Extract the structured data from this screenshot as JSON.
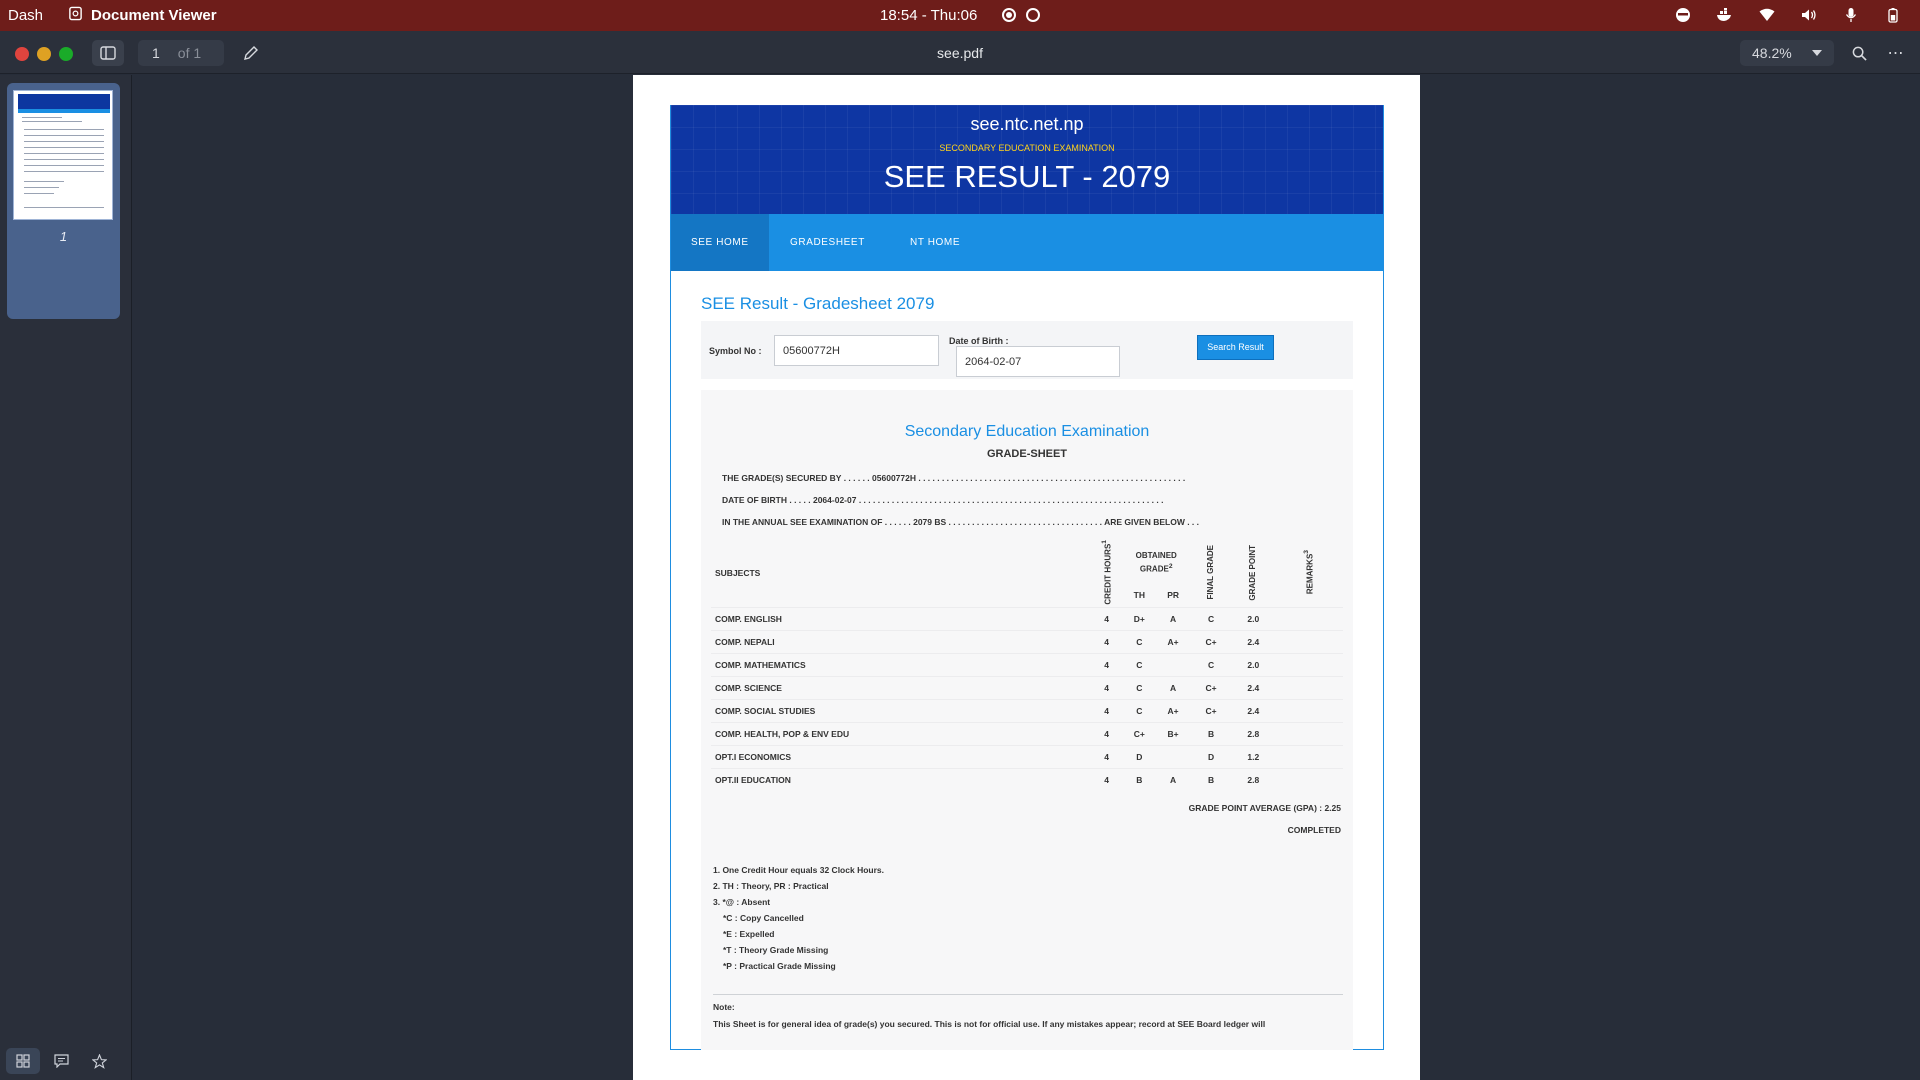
{
  "system_bar": {
    "dash_label": "Dash",
    "app_name": "Document Viewer",
    "clock": "18:54 - Thu:06"
  },
  "toolbar": {
    "page_number": "1",
    "page_of": "of 1",
    "file_name": "see.pdf",
    "zoom": "48.2%"
  },
  "sidebar": {
    "thumbnail_label": "1"
  },
  "document": {
    "site_domain": "see.ntc.net.np",
    "site_subtitle": "SECONDARY EDUCATION EXAMINATION",
    "site_title": "SEE RESULT - 2079",
    "nav": [
      "SEE HOME",
      "GRADESHEET",
      "NT HOME"
    ],
    "gradesheet_title": "SEE Result - Gradesheet 2079",
    "form": {
      "symbol_label": "Symbol No :",
      "symbol_value": "05600772H",
      "dob_label": "Date of Birth :",
      "dob_value": "2064-02-07",
      "search_button": "Search Result"
    },
    "sheet": {
      "title": "Secondary Education Examination",
      "subtitle": "GRADE-SHEET",
      "line1": "THE GRADE(S) SECURED BY . . . . . . 05600772H . . . . . . . . . . . . . . . . . . . . . . . . . . . . . . . . . . . . . . . . . . . . . . . . . . . . . . . . .",
      "line2": "DATE OF BIRTH . . . . . 2064-02-07 . . . . . . . . . . . . . . . . . . . . . . . . . . . . . . . . . . . . . . . . . . . . . . . . . . . . . . . . . . . . . . . . .",
      "line3": "IN THE ANNUAL SEE EXAMINATION OF . . . . . . 2079 BS . . . . . . . . . . . . . . . . . . . . . . . . . . . . . . . . . ARE GIVEN BELOW . . .",
      "headers": {
        "subjects": "SUBJECTS",
        "credit_hours": "CREDIT HOURS",
        "credit_sup": "1",
        "obtained_grade": "OBTAINED GRADE",
        "obtained_sup": "2",
        "th": "TH",
        "pr": "PR",
        "final_grade": "FINAL GRADE",
        "grade_point": "GRADE POINT",
        "remarks": "REMARKS",
        "remarks_sup": "3"
      },
      "rows": [
        {
          "subject": "COMP. ENGLISH",
          "credit": "4",
          "th": "D+",
          "pr": "A",
          "final": "C",
          "gp": "2.0"
        },
        {
          "subject": "COMP. NEPALI",
          "credit": "4",
          "th": "C",
          "pr": "A+",
          "final": "C+",
          "gp": "2.4"
        },
        {
          "subject": "COMP. MATHEMATICS",
          "credit": "4",
          "th": "C",
          "pr": "",
          "final": "C",
          "gp": "2.0"
        },
        {
          "subject": "COMP. SCIENCE",
          "credit": "4",
          "th": "C",
          "pr": "A",
          "final": "C+",
          "gp": "2.4"
        },
        {
          "subject": "COMP. SOCIAL STUDIES",
          "credit": "4",
          "th": "C",
          "pr": "A+",
          "final": "C+",
          "gp": "2.4"
        },
        {
          "subject": "COMP. HEALTH, POP & ENV EDU",
          "credit": "4",
          "th": "C+",
          "pr": "B+",
          "final": "B",
          "gp": "2.8"
        },
        {
          "subject": "OPT.I ECONOMICS",
          "credit": "4",
          "th": "D",
          "pr": "",
          "final": "D",
          "gp": "1.2"
        },
        {
          "subject": "OPT.II EDUCATION",
          "credit": "4",
          "th": "B",
          "pr": "A",
          "final": "B",
          "gp": "2.8"
        }
      ],
      "gpa": "GRADE POINT AVERAGE (GPA) : 2.25",
      "status": "COMPLETED",
      "footnotes": [
        "1. One Credit Hour equals 32 Clock Hours.",
        "2. TH : Theory, PR : Practical",
        "3. *@ : Absent",
        "*C : Copy Cancelled",
        "*E : Expelled",
        "*T : Theory Grade Missing",
        "*P : Practical Grade Missing"
      ],
      "note_label": "Note:",
      "note_text": "This Sheet is for general idea of grade(s) you secured. This is not for official use. If any mistakes appear; record at SEE Board ledger will"
    }
  }
}
